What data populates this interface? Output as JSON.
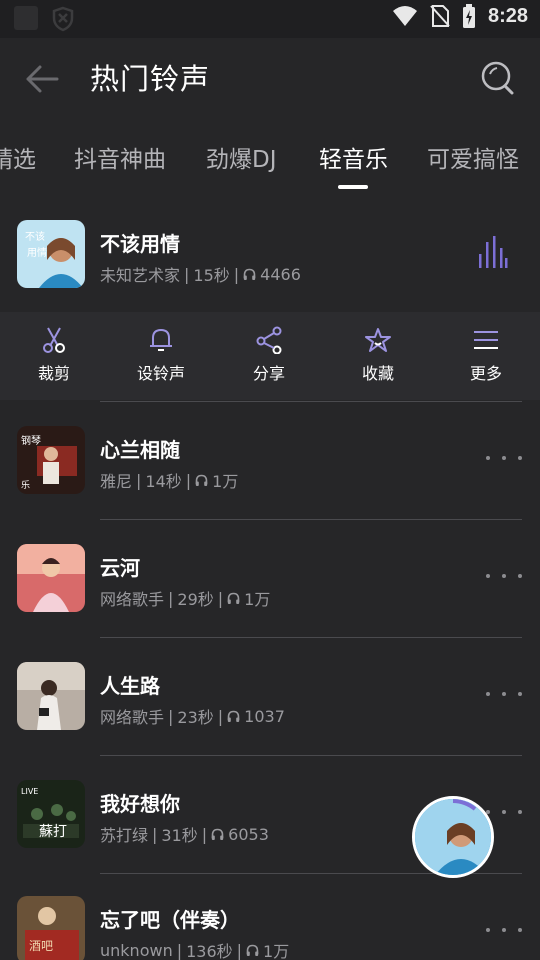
{
  "status_bar": {
    "time": "8:28"
  },
  "header": {
    "title": "热门铃声"
  },
  "tabs": [
    {
      "label": "精选"
    },
    {
      "label": "抖音神曲"
    },
    {
      "label": "劲爆DJ"
    },
    {
      "label": "轻音乐",
      "active": true
    },
    {
      "label": "可爱搞怪"
    }
  ],
  "playing": {
    "title": "不该用情",
    "artist": "未知艺术家",
    "duration": "15秒",
    "plays": "4466"
  },
  "actions": [
    {
      "label": "裁剪",
      "icon": "scissors-icon"
    },
    {
      "label": "设铃声",
      "icon": "bell-icon"
    },
    {
      "label": "分享",
      "icon": "share-icon"
    },
    {
      "label": "收藏",
      "icon": "star-icon"
    },
    {
      "label": "更多",
      "icon": "menu-icon"
    }
  ],
  "songs": [
    {
      "title": "心兰相随",
      "artist": "雅尼",
      "duration": "14秒",
      "plays": "1万"
    },
    {
      "title": "云河",
      "artist": "网络歌手",
      "duration": "29秒",
      "plays": "1万"
    },
    {
      "title": "人生路",
      "artist": "网络歌手",
      "duration": "23秒",
      "plays": "1037"
    },
    {
      "title": "我好想你",
      "artist": "苏打绿",
      "duration": "31秒",
      "plays": "6053"
    },
    {
      "title": "忘了吧（伴奏）",
      "artist": "unknown",
      "duration": "136秒",
      "plays": "1万"
    }
  ],
  "colors": {
    "background": "#262628",
    "accent": "#7c6fd6",
    "secondary_text": "#9a9a9e"
  }
}
